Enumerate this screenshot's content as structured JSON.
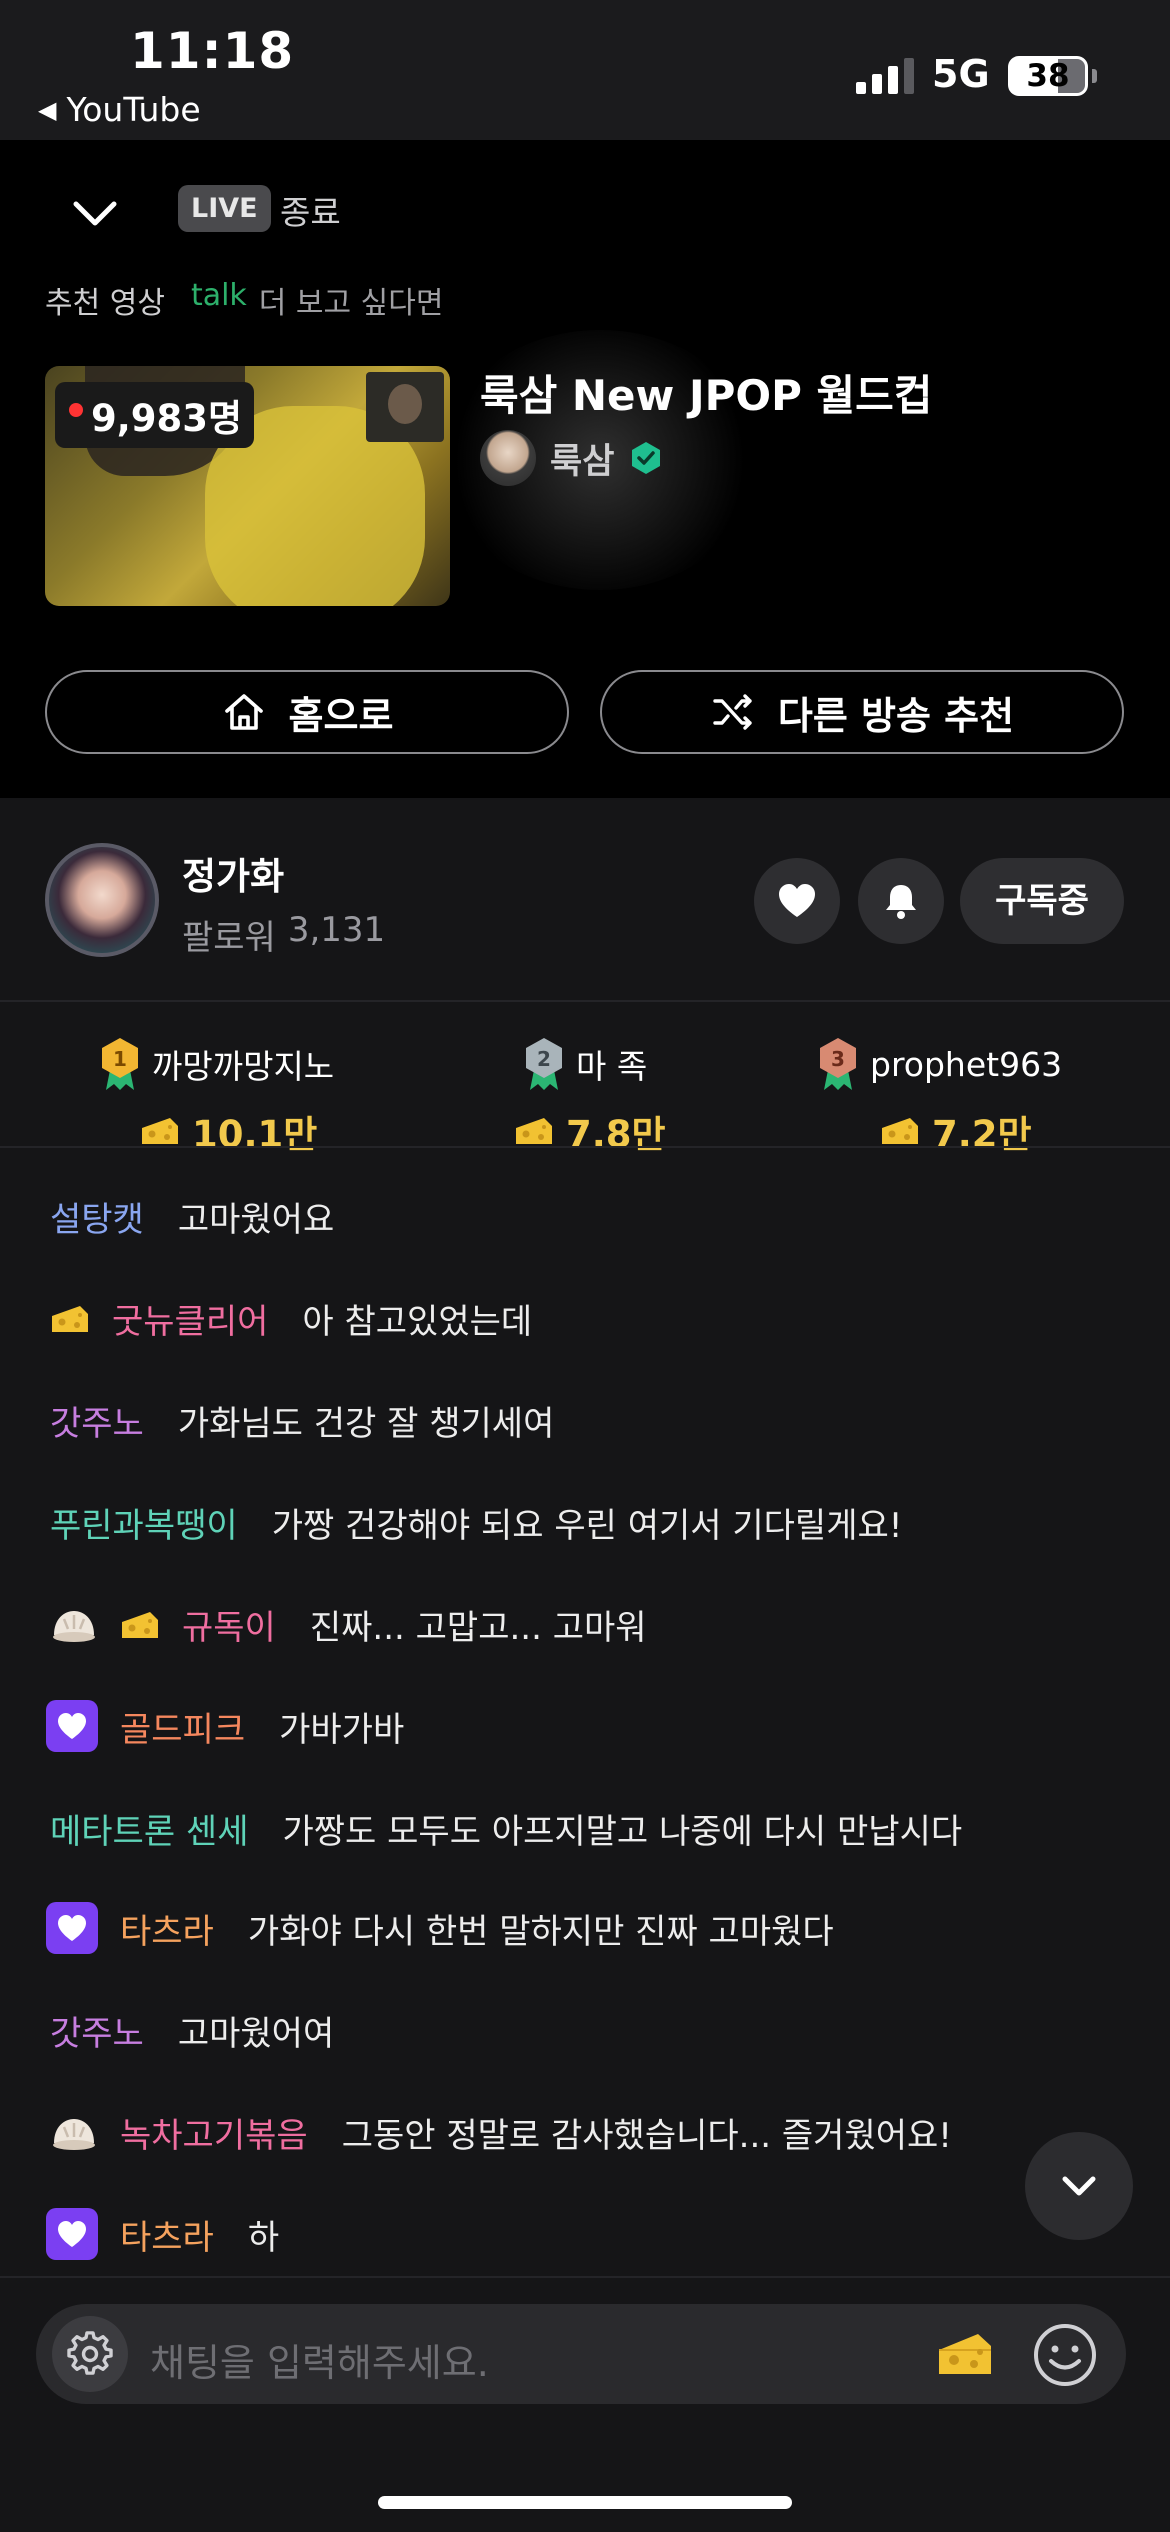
{
  "status_bar": {
    "time": "11:18",
    "back_app": "YouTube",
    "network": "5G",
    "battery": "38"
  },
  "ended_panel": {
    "live_badge": "LIVE",
    "end_label": "종료",
    "recommend_label": "추천 영상",
    "talk_label": "talk",
    "talk_rest": "더 보고 싶다면",
    "video": {
      "viewers": "9,983명",
      "title": "룩삼 New JPOP 월드컵",
      "channel": "룩삼"
    },
    "home_button": "홈으로",
    "other_button": "다른 방송 추천"
  },
  "streamer": {
    "name": "정가화",
    "followers_label": "팔로워",
    "followers_count": "3,131",
    "subscribe_button": "구독중"
  },
  "ranking": [
    {
      "rank": "1",
      "name": "까망까망지노",
      "amount": "10.1만",
      "color": "#f2b632"
    },
    {
      "rank": "2",
      "name": "마 족",
      "amount": "7.8만",
      "color": "#9aa7b0"
    },
    {
      "rank": "3",
      "name": "prophet963",
      "amount": "7.2만",
      "color": "#d88a72"
    }
  ],
  "chat": [
    {
      "nick": "설탕캣",
      "text": "고마웠어요",
      "nick_color": "#8aa6f0",
      "badges": []
    },
    {
      "nick": "굿뉴클리어",
      "text": "아 참고있었는데",
      "nick_color": "#f06ea0",
      "badges": [
        "cheese"
      ]
    },
    {
      "nick": "갓주노",
      "text": "가화님도 건강 잘 챙기세여",
      "nick_color": "#c77ee0",
      "badges": []
    },
    {
      "nick": "푸린과복땡이",
      "text": "가짱 건강해야 되요 우린 여기서 기다릴게요!",
      "nick_color": "#5fd3b8",
      "badges": []
    },
    {
      "nick": "규독이",
      "text": "진짜... 고맙고... 고마워",
      "nick_color": "#f06ea0",
      "badges": [
        "dumpling",
        "cheese"
      ]
    },
    {
      "nick": "골드피크",
      "text": "가바가바",
      "nick_color": "#f5875e",
      "badges": [
        "subscriber"
      ]
    },
    {
      "nick": "메타트론 센세",
      "text": "가짱도 모두도 아프지말고 나중에 다시 만납시다",
      "nick_color": "#5fd3b8",
      "badges": []
    },
    {
      "nick": "타츠라",
      "text": "가화야 다시 한번 말하지만 진짜 고마웠다",
      "nick_color": "#f5a25e",
      "badges": [
        "subscriber"
      ]
    },
    {
      "nick": "갓주노",
      "text": "고마웠어여",
      "nick_color": "#c77ee0",
      "badges": []
    },
    {
      "nick": "녹차고기볶음",
      "text": "그동안 정말로 감사했습니다... 즐거웠어요!",
      "nick_color": "#f06ea0",
      "badges": [
        "dumpling"
      ]
    },
    {
      "nick": "타츠라",
      "text": "하",
      "nick_color": "#f5a25e",
      "badges": [
        "subscriber"
      ]
    }
  ],
  "input": {
    "placeholder": "채팅을 입력해주세요."
  },
  "icons": {
    "back": "chevron-down-icon",
    "home": "home-icon",
    "shuffle": "shuffle-icon",
    "heart": "heart-icon",
    "bell": "bell-icon",
    "settings": "gear-icon",
    "cheese": "cheese-icon",
    "emoji": "smile-icon",
    "scroll": "chevron-down-icon"
  },
  "accent_colors": {
    "talk_green": "#2db06b",
    "gold": "#f2c94c",
    "subscriber_purple": "#7b3ff2",
    "live_dot": "#ff3333"
  }
}
